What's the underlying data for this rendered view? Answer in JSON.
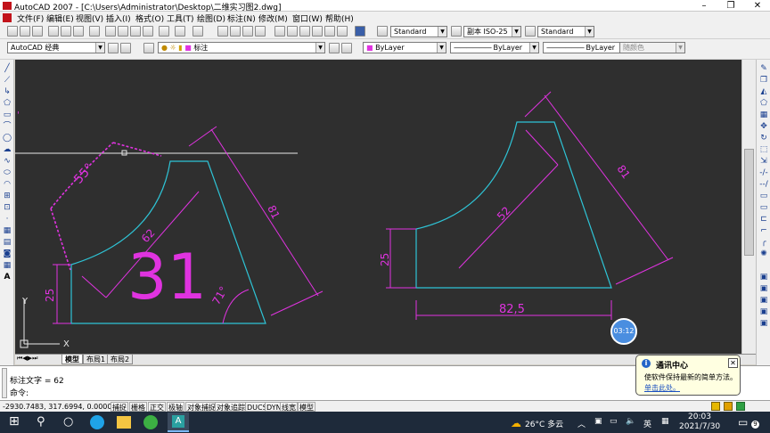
{
  "window": {
    "title": "AutoCAD 2007 - [C:\\Users\\Administrator\\Desktop\\二维实习图2.dwg]",
    "min_glyph": "–",
    "restore_glyph": "❐",
    "close_glyph": "✕"
  },
  "menu": [
    "文件(F)",
    "编辑(E)",
    "视图(V)",
    "插入(I)",
    "格式(O)",
    "工具(T)",
    "绘图(D)",
    "标注(N)",
    "修改(M)",
    "窗口(W)",
    "帮助(H)"
  ],
  "toolbar1": {
    "text_style": "Standard",
    "dim_style": "副本 ISO-25",
    "table_style": "Standard"
  },
  "toolbar2": {
    "workspace": "AutoCAD 经典",
    "layer": "标注",
    "color": "ByLayer",
    "linetype": "ByLayer",
    "lineweight": "ByLayer",
    "plotstyle": "随颜色"
  },
  "drawing": {
    "left_dims": {
      "angle_55": "55°",
      "radius_62": "62",
      "length_81": "81",
      "height_25": "25",
      "angle_71": "71°"
    },
    "big_number": "31",
    "right_dims": {
      "length_81": "81",
      "radius_52": "52",
      "height_25": "25",
      "width_825": "82,5"
    },
    "ucs_x": "X",
    "ucs_y": "Y"
  },
  "timer": "03:12",
  "layout_tabs": [
    "模型",
    "布局1",
    "布局2"
  ],
  "command": {
    "line1": "标注文字 = 62",
    "line2": "命令:"
  },
  "status": {
    "coords": "-2930.7483, 317.6994, 0.0000",
    "buttons": [
      "捕捉",
      "栅格",
      "正交",
      "极轴",
      "对象捕捉",
      "对象追踪",
      "DUCS",
      "DYN",
      "线宽",
      "模型"
    ]
  },
  "balloon": {
    "title": "通讯中心",
    "body": "使软件保持最新的简单方法。",
    "link": "单击此处。"
  },
  "taskbar": {
    "weather": "26°C 多云",
    "ime": "英",
    "time": "20:03",
    "date": "2021/7/30",
    "notif": "9"
  },
  "colors": {
    "canvas_bg": "#2f2f2f",
    "cyan_line": "#2ec4d6",
    "magenta_dim": "#e033e0",
    "white_line": "#e8e8e8"
  }
}
